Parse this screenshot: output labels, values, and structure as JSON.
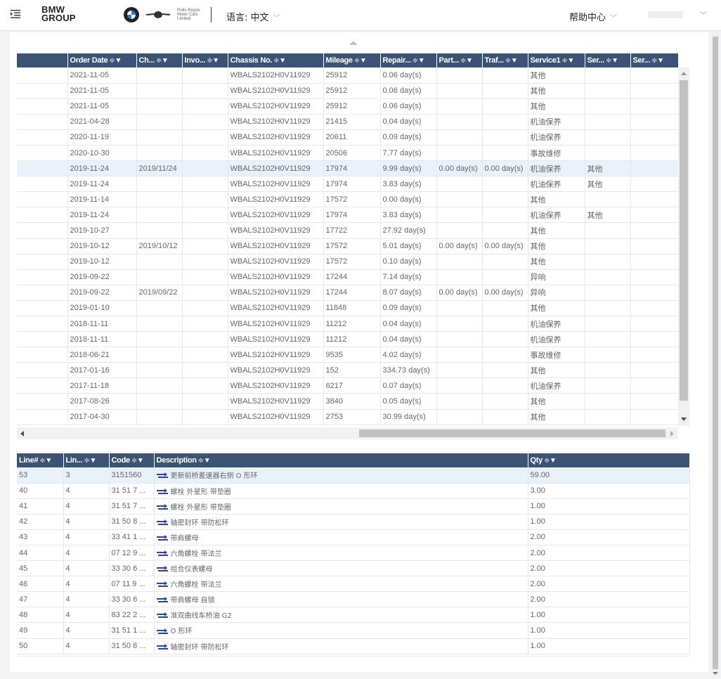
{
  "header": {
    "logo_line1": "BMW",
    "logo_line2": "GROUP",
    "rolls_royce": "Rolls-Royce Motor Cars Limited",
    "language_label": "语言: 中文",
    "help_label": "帮助中心"
  },
  "grid1": {
    "columns": [
      "",
      "Order Date",
      "Ch...",
      "Invo...",
      "Chassis No.",
      "Mileage",
      "Repair...",
      "Part...",
      "Traf...",
      "Service1",
      "Ser...",
      "Ser..."
    ],
    "sort_glyph": "≑▼",
    "rows": [
      [
        "",
        "2021-11-05",
        "",
        "",
        "WBALS2102H0V11929",
        "25912",
        "0.06 day(s)",
        "",
        "",
        "其他",
        "",
        ""
      ],
      [
        "",
        "2021-11-05",
        "",
        "",
        "WBALS2102H0V11929",
        "25912",
        "0.06 day(s)",
        "",
        "",
        "其他",
        "",
        ""
      ],
      [
        "",
        "2021-11-05",
        "",
        "",
        "WBALS2102H0V11929",
        "25912",
        "0.06 day(s)",
        "",
        "",
        "其他",
        "",
        ""
      ],
      [
        "",
        "2021-04-28",
        "",
        "",
        "WBALS2102H0V11929",
        "21415",
        "0.04 day(s)",
        "",
        "",
        "机油保养",
        "",
        ""
      ],
      [
        "",
        "2020-11-19",
        "",
        "",
        "WBALS2102H0V11929",
        "20611",
        "0.09 day(s)",
        "",
        "",
        "机油保养",
        "",
        ""
      ],
      [
        "",
        "2020-10-30",
        "",
        "",
        "WBALS2102H0V11929",
        "20506",
        "7.77 day(s)",
        "",
        "",
        "事故维修",
        "",
        ""
      ],
      [
        "",
        "2019-11-24",
        "2019/11/24",
        "",
        "WBALS2102H0V11929",
        "17974",
        "9.99 day(s)",
        "0.00 day(s)",
        "0.00 day(s)",
        "机油保养",
        "其他",
        ""
      ],
      [
        "",
        "2019-11-24",
        "",
        "",
        "WBALS2102H0V11929",
        "17974",
        "3.83 day(s)",
        "",
        "",
        "机油保养",
        "其他",
        ""
      ],
      [
        "",
        "2019-11-14",
        "",
        "",
        "WBALS2102H0V11929",
        "17572",
        "0.00 day(s)",
        "",
        "",
        "其他",
        "",
        ""
      ],
      [
        "",
        "2019-11-24",
        "",
        "",
        "WBALS2102H0V11929",
        "17974",
        "3.83 day(s)",
        "",
        "",
        "机油保养",
        "其他",
        ""
      ],
      [
        "",
        "2019-10-27",
        "",
        "",
        "WBALS2102H0V11929",
        "17722",
        "27.92 day(s)",
        "",
        "",
        "其他",
        "",
        ""
      ],
      [
        "",
        "2019-10-12",
        "2019/10/12",
        "",
        "WBALS2102H0V11929",
        "17572",
        "5.01 day(s)",
        "0.00 day(s)",
        "0.00 day(s)",
        "其他",
        "",
        ""
      ],
      [
        "",
        "2019-10-12",
        "",
        "",
        "WBALS2102H0V11929",
        "17572",
        "0.10 day(s)",
        "",
        "",
        "其他",
        "",
        ""
      ],
      [
        "",
        "2019-09-22",
        "",
        "",
        "WBALS2102H0V11929",
        "17244",
        "7.14 day(s)",
        "",
        "",
        "异响",
        "",
        ""
      ],
      [
        "",
        "2019-09-22",
        "2019/09/22",
        "",
        "WBALS2102H0V11929",
        "17244",
        "8.07 day(s)",
        "0.00 day(s)",
        "0.00 day(s)",
        "异响",
        "",
        ""
      ],
      [
        "",
        "2019-01-10",
        "",
        "",
        "WBALS2102H0V11929",
        "11848",
        "0.09 day(s)",
        "",
        "",
        "其他",
        "",
        ""
      ],
      [
        "",
        "2018-11-11",
        "",
        "",
        "WBALS2102H0V11929",
        "11212",
        "0.04 day(s)",
        "",
        "",
        "机油保养",
        "",
        ""
      ],
      [
        "",
        "2018-11-11",
        "",
        "",
        "WBALS2102H0V11929",
        "11212",
        "0.04 day(s)",
        "",
        "",
        "机油保养",
        "",
        ""
      ],
      [
        "",
        "2018-06-21",
        "",
        "",
        "WBALS2102H0V11929",
        "9535",
        "4.02 day(s)",
        "",
        "",
        "事故维修",
        "",
        ""
      ],
      [
        "",
        "2017-01-16",
        "",
        "",
        "WBALS2102H0V11929",
        "152",
        "334.73 day(s)",
        "",
        "",
        "其他",
        "",
        ""
      ],
      [
        "",
        "2017-11-18",
        "",
        "",
        "WBALS2102H0V11929",
        "6217",
        "0.07 day(s)",
        "",
        "",
        "机油保养",
        "",
        ""
      ],
      [
        "",
        "2017-08-26",
        "",
        "",
        "WBALS2102H0V11929",
        "3840",
        "0.05 day(s)",
        "",
        "",
        "其他",
        "",
        ""
      ],
      [
        "",
        "2017-04-30",
        "",
        "",
        "WBALS2102H0V11929",
        "2753",
        "30.99 day(s)",
        "",
        "",
        "其他",
        "",
        ""
      ]
    ],
    "selected_row": 6
  },
  "grid2": {
    "columns": [
      "Line#",
      "Lin...",
      "Code",
      "Description",
      "Qty"
    ],
    "rows": [
      [
        "53",
        "3",
        "3151560",
        "更新前桥差速器右侧 O 形环",
        "59.00"
      ],
      [
        "40",
        "4",
        "31 51 7 ...",
        "螺栓 外星形 带垫圈",
        "3.00"
      ],
      [
        "41",
        "4",
        "31 51 7 ...",
        "螺栓 外星形 带垫圈",
        "1.00"
      ],
      [
        "42",
        "4",
        "31 50 8 ...",
        "轴密封环 带防松环",
        "1.00"
      ],
      [
        "43",
        "4",
        "33 41 1 ...",
        "带肩螺母",
        "2.00"
      ],
      [
        "44",
        "4",
        "07 12 9 ...",
        "六角螺栓 带法兰",
        "2.00"
      ],
      [
        "45",
        "4",
        "33 30 6 ...",
        "组合仪表螺母",
        "2.00"
      ],
      [
        "46",
        "4",
        "07 11 9 ...",
        "六角螺栓 带法兰",
        "2.00"
      ],
      [
        "47",
        "4",
        "33 30 6 ...",
        "带肩螺母 自锁",
        "2.00"
      ],
      [
        "48",
        "4",
        "83 22 2 ...",
        "准双曲线车桥油 G2",
        "1.00"
      ],
      [
        "49",
        "4",
        "31 51 1 ...",
        "O 形环",
        "1.00"
      ],
      [
        "50",
        "4",
        "31 50 8 ...",
        "轴密封环 带防松环",
        "1.00"
      ]
    ],
    "selected_row": 0
  },
  "colors": {
    "header_bg": "#3b5475",
    "selected_row": "#e9f1fb",
    "icon_blue": "#2b3fb8"
  }
}
